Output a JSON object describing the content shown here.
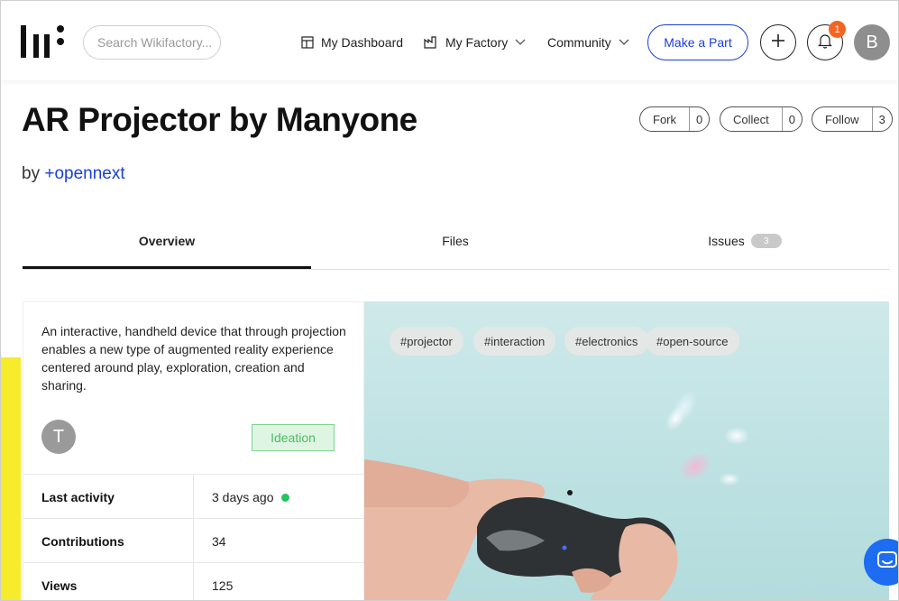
{
  "header": {
    "search_placeholder": "Search Wikifactory...",
    "nav": {
      "dashboard": "My Dashboard",
      "factory": "My Factory",
      "community": "Community"
    },
    "make_part": "Make a Part",
    "notification_count": "1",
    "user_initial": "B"
  },
  "project": {
    "title": "AR Projector by Manyone",
    "by_prefix": "by",
    "author": "+opennext",
    "actions": [
      {
        "label": "Fork",
        "count": "0"
      },
      {
        "label": "Collect",
        "count": "0"
      },
      {
        "label": "Follow",
        "count": "3"
      }
    ]
  },
  "tabs": {
    "overview": "Overview",
    "files": "Files",
    "issues": "Issues",
    "issues_count": "3"
  },
  "card": {
    "description": "An interactive, handheld device that through projection enables a new type of augmented reality experience centered around play, exploration, creation and sharing.",
    "avatar_initial": "T",
    "stage": "Ideation",
    "stats": [
      {
        "label": "Last activity",
        "value": "3 days ago"
      },
      {
        "label": "Contributions",
        "value": "34"
      },
      {
        "label": "Views",
        "value": "125"
      }
    ]
  },
  "hero": {
    "tags": [
      "#projector",
      "#interaction",
      "#electronics",
      "#open-source"
    ]
  },
  "colors": {
    "accent": "#1a3fd8",
    "badge": "#f26522",
    "stage_green": "#4dbb61",
    "online": "#22c55e",
    "chat": "#1d6cf2"
  }
}
